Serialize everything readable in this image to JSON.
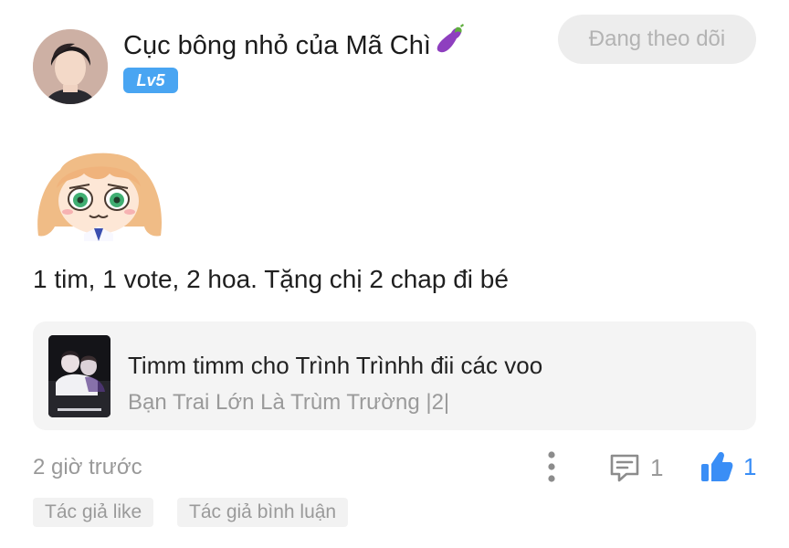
{
  "author": {
    "name": "Cục bông nhỏ của Mã Chì",
    "name_emoji": "eggplant-emoji",
    "level": "Lv5",
    "follow_label": "Đang theo dõi"
  },
  "comment": {
    "sticker": "anime-girl-sticker",
    "text": "1 tim, 1 vote, 2 hoa. Tặng chị 2 chap đi bé"
  },
  "reference": {
    "title": "Timm timm cho Trình Trìnhh đii các voo",
    "subtitle": "Bạn Trai Lớn Là Trùm Trường |2|"
  },
  "footer": {
    "time": "2 giờ trước",
    "reply_count": "1",
    "like_count": "1",
    "like_color": "#3a8ef6",
    "tags": [
      "Tác giả like",
      "Tác giả bình luận"
    ]
  }
}
